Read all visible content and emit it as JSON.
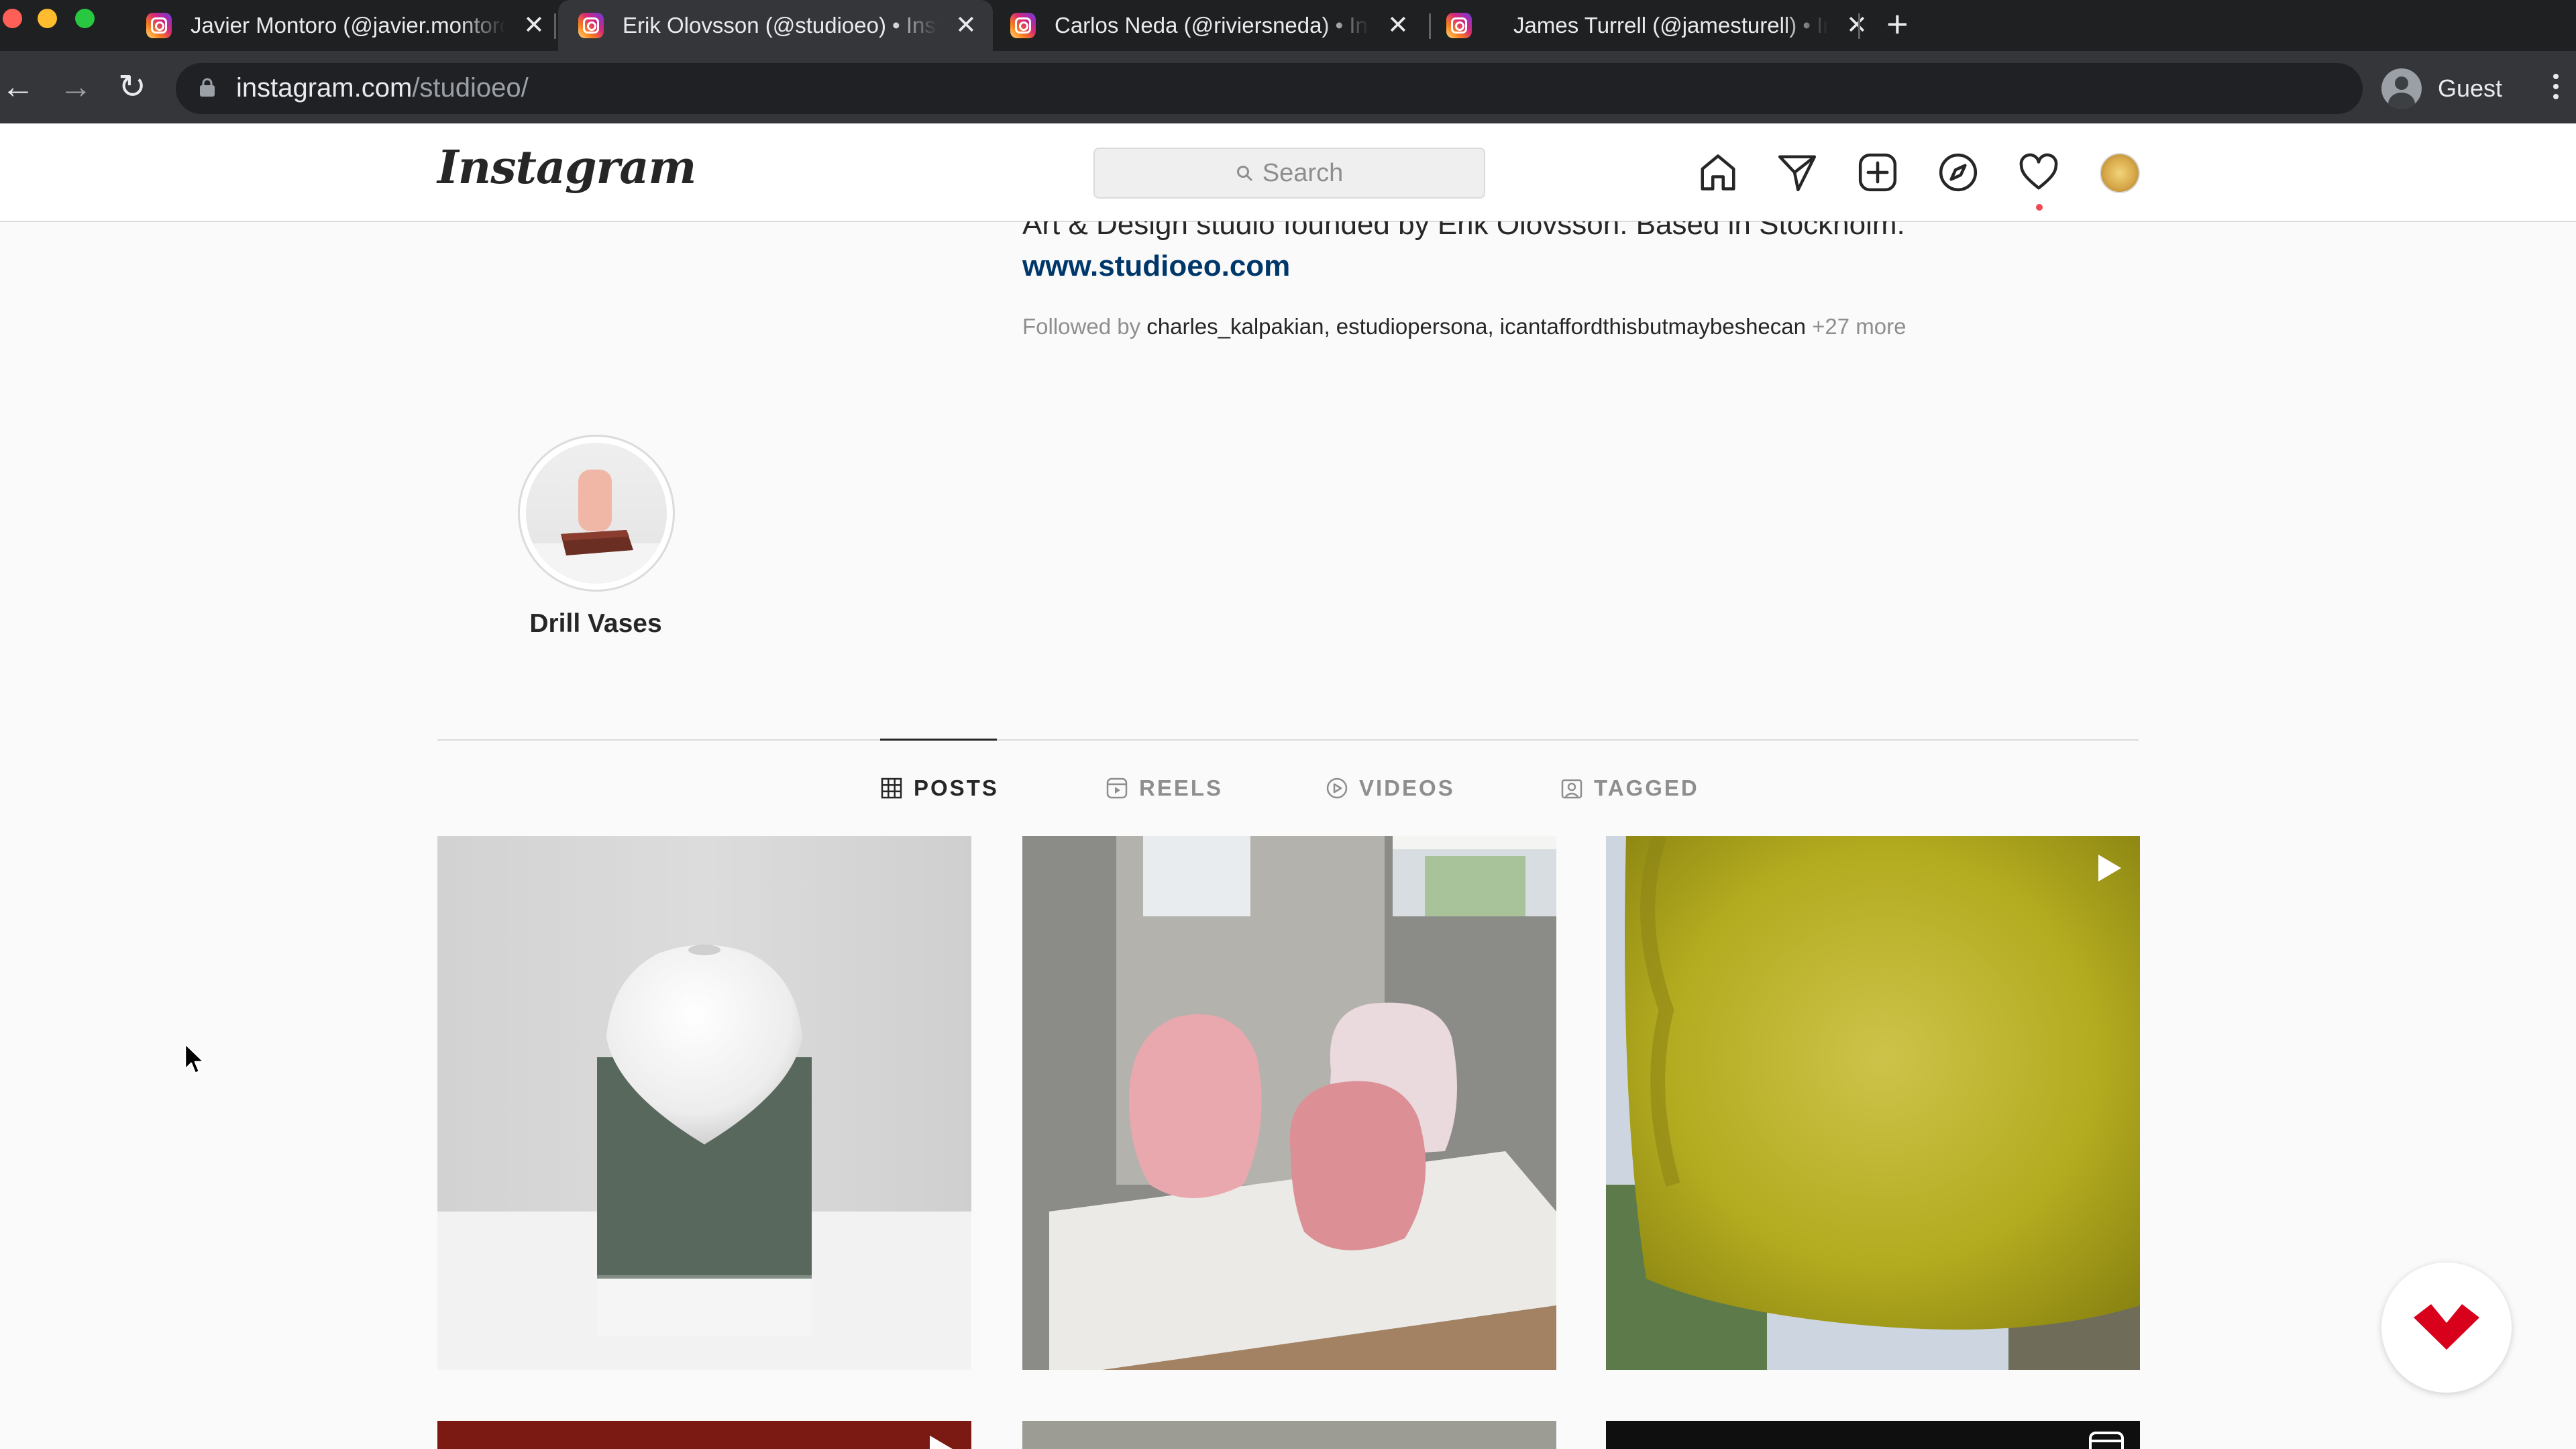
{
  "browser": {
    "tabs": [
      {
        "title": "Javier Montoro (@javier.montoro) • Instagram"
      },
      {
        "title": "Erik Olovsson (@studioeo) • Instagram"
      },
      {
        "title": "Carlos Neda (@riviersneda) • Instagram"
      },
      {
        "title": "James Turrell (@jamesturell) • Instagram"
      }
    ],
    "new_tab": "+",
    "url_host": "instagram.com",
    "url_path": "/studioeo/",
    "profile_label": "Guest"
  },
  "ig": {
    "logo": "Instagram",
    "search_placeholder": "Search"
  },
  "profile": {
    "bio": "Art & Design studio founded by Erik Olovsson. Based in Stockholm.",
    "website": "www.studioeo.com",
    "followed_prefix": "Followed by ",
    "followers": [
      "charles_kalpakian",
      "estudiopersona",
      "icantaffordthisbutmaybeshecan"
    ],
    "followers_sep": ", ",
    "followed_more": " +27 more",
    "highlight": "Drill Vases"
  },
  "tabs": {
    "posts": "POSTS",
    "reels": "REELS",
    "videos": "VIDEOS",
    "tagged": "TAGGED"
  },
  "colors": {
    "accent_blue": "#00376b",
    "notification_red": "#ed4956",
    "fab_red": "#d9001b"
  }
}
